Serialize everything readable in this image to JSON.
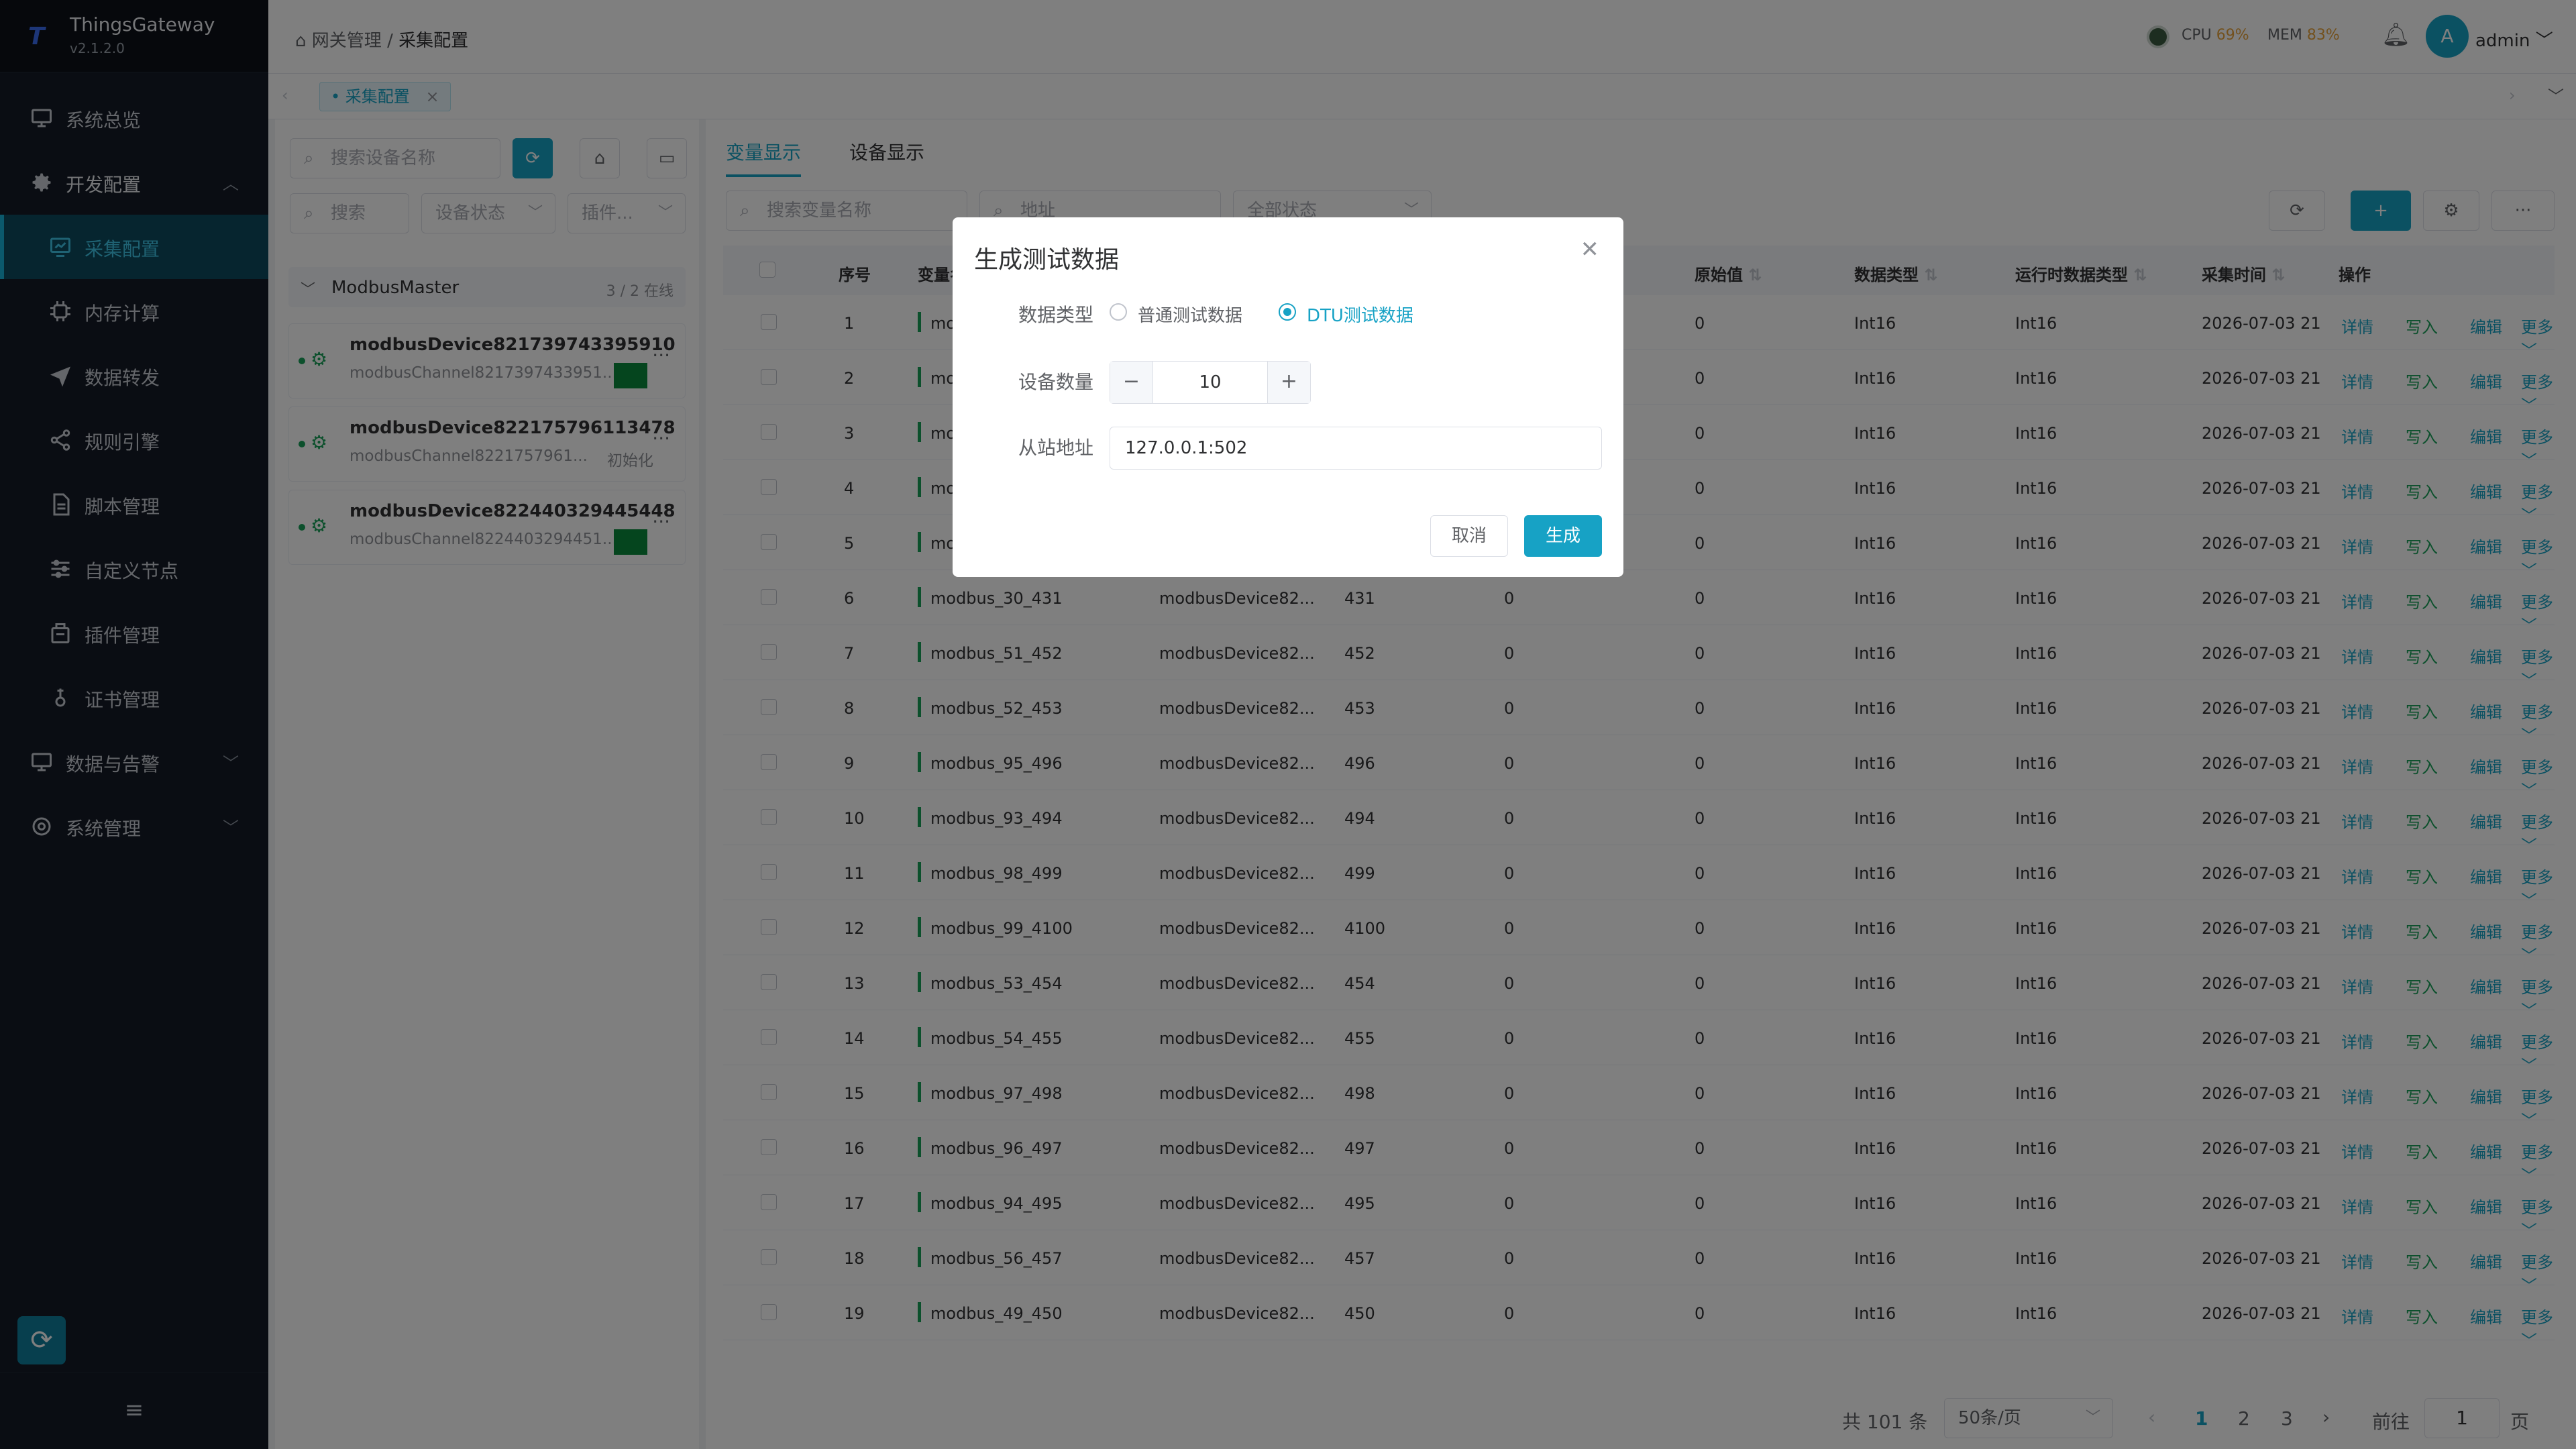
{
  "app": {
    "name": "ThingsGateway",
    "version": "v2.1.2.0"
  },
  "sidebar": {
    "items": [
      {
        "label": "系统总览",
        "icon": "monitor-icon"
      },
      {
        "label": "开发配置",
        "icon": "gear-icon"
      },
      {
        "label": "采集配置",
        "icon": "collect-icon"
      },
      {
        "label": "内存计算",
        "icon": "chip-icon"
      },
      {
        "label": "数据转发",
        "icon": "send-icon"
      },
      {
        "label": "规则引擎",
        "icon": "share-icon"
      },
      {
        "label": "脚本管理",
        "icon": "file-icon"
      },
      {
        "label": "自定义节点",
        "icon": "sliders-icon"
      },
      {
        "label": "插件管理",
        "icon": "plugin-icon"
      },
      {
        "label": "证书管理",
        "icon": "cert-icon"
      },
      {
        "label": "数据与告警",
        "icon": "monitor-icon"
      },
      {
        "label": "系统管理",
        "icon": "gear-icon"
      }
    ]
  },
  "topbar": {
    "breadcrumb": [
      "网关管理",
      "采集配置"
    ],
    "cpu_label": "CPU",
    "cpu_value": "69%",
    "mem_label": "MEM",
    "mem_value": "83%",
    "user": "admin",
    "avatar_letter": "A"
  },
  "tabs": {
    "open_tab": "采集配置"
  },
  "left_panel": {
    "search_device_placeholder": "搜索设备名称",
    "search_placeholder": "搜索",
    "status_select": "设备状态",
    "plugin_select": "插件...",
    "group_name": "ModbusMaster",
    "group_count": "3 / 2 在线",
    "devices": [
      {
        "name": "modbusDevice821739743395910",
        "channel": "modbusChannel8217397433951...",
        "status": ""
      },
      {
        "name": "modbusDevice822175796113478",
        "channel": "modbusChannel8221757961...",
        "status": "初始化"
      },
      {
        "name": "modbusDevice822440329445448",
        "channel": "modbusChannel8224403294451...",
        "status": ""
      }
    ]
  },
  "main": {
    "tabs": [
      "变量显示",
      "设备显示"
    ],
    "filters": {
      "var_placeholder": "搜索变量名称",
      "addr_placeholder": "地址",
      "status": "全部状态"
    },
    "columns": [
      "序号",
      "变量名称",
      "原始值",
      "数据类型",
      "运行时数据类型",
      "采集时间",
      "操作"
    ],
    "ops": [
      "详情",
      "写入",
      "编辑",
      "更多"
    ],
    "rows": [
      {
        "idx": "1",
        "name": "modbus",
        "device": "",
        "addr": "",
        "value": "",
        "raw": "0",
        "type": "Int16",
        "rtype": "Int16",
        "time": "2026-07-03 21:"
      },
      {
        "idx": "2",
        "name": "modbus",
        "device": "",
        "addr": "",
        "value": "",
        "raw": "0",
        "type": "Int16",
        "rtype": "Int16",
        "time": "2026-07-03 21:"
      },
      {
        "idx": "3",
        "name": "modbus",
        "device": "",
        "addr": "",
        "value": "",
        "raw": "0",
        "type": "Int16",
        "rtype": "Int16",
        "time": "2026-07-03 21:"
      },
      {
        "idx": "4",
        "name": "modbus",
        "device": "",
        "addr": "",
        "value": "",
        "raw": "0",
        "type": "Int16",
        "rtype": "Int16",
        "time": "2026-07-03 21:"
      },
      {
        "idx": "5",
        "name": "modbus",
        "device": "",
        "addr": "",
        "value": "",
        "raw": "0",
        "type": "Int16",
        "rtype": "Int16",
        "time": "2026-07-03 21:"
      },
      {
        "idx": "6",
        "name": "modbus_30_431",
        "device": "modbusDevice82...",
        "addr": "431",
        "value": "0",
        "raw": "0",
        "type": "Int16",
        "rtype": "Int16",
        "time": "2026-07-03 21:"
      },
      {
        "idx": "7",
        "name": "modbus_51_452",
        "device": "modbusDevice82...",
        "addr": "452",
        "value": "0",
        "raw": "0",
        "type": "Int16",
        "rtype": "Int16",
        "time": "2026-07-03 21:"
      },
      {
        "idx": "8",
        "name": "modbus_52_453",
        "device": "modbusDevice82...",
        "addr": "453",
        "value": "0",
        "raw": "0",
        "type": "Int16",
        "rtype": "Int16",
        "time": "2026-07-03 21:"
      },
      {
        "idx": "9",
        "name": "modbus_95_496",
        "device": "modbusDevice82...",
        "addr": "496",
        "value": "0",
        "raw": "0",
        "type": "Int16",
        "rtype": "Int16",
        "time": "2026-07-03 21:"
      },
      {
        "idx": "10",
        "name": "modbus_93_494",
        "device": "modbusDevice82...",
        "addr": "494",
        "value": "0",
        "raw": "0",
        "type": "Int16",
        "rtype": "Int16",
        "time": "2026-07-03 21:"
      },
      {
        "idx": "11",
        "name": "modbus_98_499",
        "device": "modbusDevice82...",
        "addr": "499",
        "value": "0",
        "raw": "0",
        "type": "Int16",
        "rtype": "Int16",
        "time": "2026-07-03 21:"
      },
      {
        "idx": "12",
        "name": "modbus_99_4100",
        "device": "modbusDevice82...",
        "addr": "4100",
        "value": "0",
        "raw": "0",
        "type": "Int16",
        "rtype": "Int16",
        "time": "2026-07-03 21:"
      },
      {
        "idx": "13",
        "name": "modbus_53_454",
        "device": "modbusDevice82...",
        "addr": "454",
        "value": "0",
        "raw": "0",
        "type": "Int16",
        "rtype": "Int16",
        "time": "2026-07-03 21:"
      },
      {
        "idx": "14",
        "name": "modbus_54_455",
        "device": "modbusDevice82...",
        "addr": "455",
        "value": "0",
        "raw": "0",
        "type": "Int16",
        "rtype": "Int16",
        "time": "2026-07-03 21:"
      },
      {
        "idx": "15",
        "name": "modbus_97_498",
        "device": "modbusDevice82...",
        "addr": "498",
        "value": "0",
        "raw": "0",
        "type": "Int16",
        "rtype": "Int16",
        "time": "2026-07-03 21:"
      },
      {
        "idx": "16",
        "name": "modbus_96_497",
        "device": "modbusDevice82...",
        "addr": "497",
        "value": "0",
        "raw": "0",
        "type": "Int16",
        "rtype": "Int16",
        "time": "2026-07-03 21:"
      },
      {
        "idx": "17",
        "name": "modbus_94_495",
        "device": "modbusDevice82...",
        "addr": "495",
        "value": "0",
        "raw": "0",
        "type": "Int16",
        "rtype": "Int16",
        "time": "2026-07-03 21:"
      },
      {
        "idx": "18",
        "name": "modbus_56_457",
        "device": "modbusDevice82...",
        "addr": "457",
        "value": "0",
        "raw": "0",
        "type": "Int16",
        "rtype": "Int16",
        "time": "2026-07-03 21:"
      },
      {
        "idx": "19",
        "name": "modbus_49_450",
        "device": "modbusDevice82...",
        "addr": "450",
        "value": "0",
        "raw": "0",
        "type": "Int16",
        "rtype": "Int16",
        "time": "2026-07-03 21:"
      }
    ],
    "pager": {
      "total": "共 101 条",
      "page_size": "50条/页",
      "pages": [
        "1",
        "2",
        "3"
      ],
      "goto_label": "前往",
      "goto_value": "1",
      "page_suffix": "页"
    }
  },
  "dialog": {
    "title": "生成测试数据",
    "data_type_label": "数据类型",
    "option_normal": "普通测试数据",
    "option_dtu": "DTU测试数据",
    "device_count_label": "设备数量",
    "device_count": "10",
    "slave_addr_label": "从站地址",
    "slave_addr": "127.0.0.1:502",
    "cancel": "取消",
    "generate": "生成"
  },
  "colors": {
    "accent": "#17a2c5",
    "sidebar_bg": "#141b26",
    "online": "#18a058",
    "cpu": "#e6a23c",
    "mem": "#f56c6c"
  }
}
